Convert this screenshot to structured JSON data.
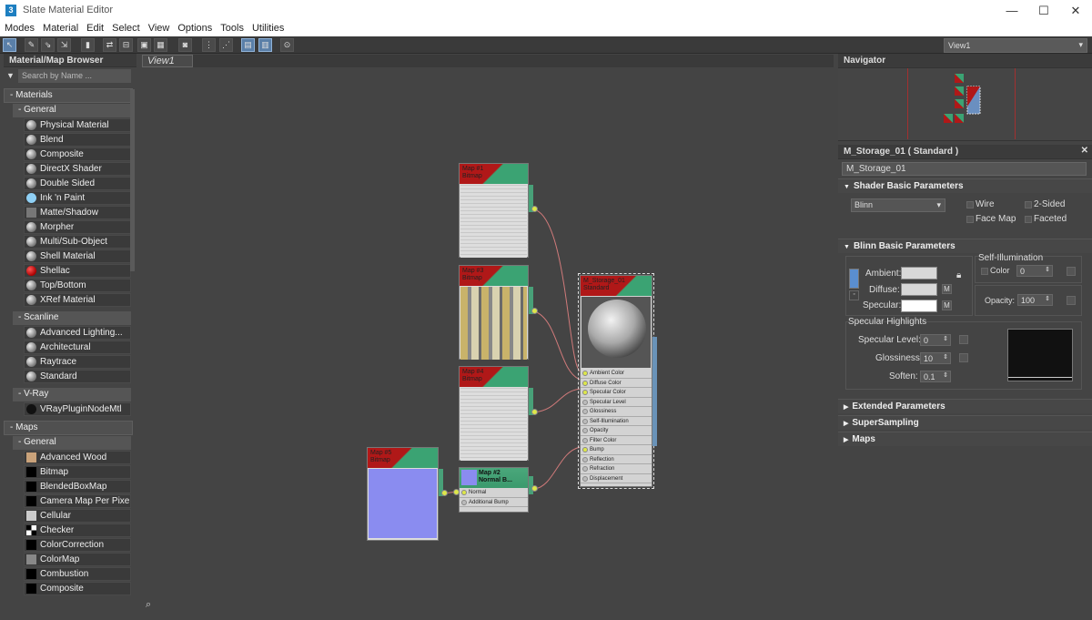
{
  "window": {
    "title": "Slate Material Editor",
    "app_icon": "3"
  },
  "menu": [
    "Modes",
    "Material",
    "Edit",
    "Select",
    "View",
    "Options",
    "Tools",
    "Utilities"
  ],
  "toolbar": {
    "view_select": "View1"
  },
  "browser": {
    "title": "Material/Map Browser",
    "search_placeholder": "Search by Name ...",
    "materials_label": "- Materials",
    "general_label": "- General",
    "general_items": [
      "Physical Material",
      "Blend",
      "Composite",
      "DirectX Shader",
      "Double Sided",
      "Ink 'n Paint",
      "Matte/Shadow",
      "Morpher",
      "Multi/Sub-Object",
      "Shell Material",
      "Shellac",
      "Top/Bottom",
      "XRef Material"
    ],
    "scanline_label": "- Scanline",
    "scanline_items": [
      "Advanced Lighting...",
      "Architectural",
      "Raytrace",
      "Standard"
    ],
    "vray_label": "- V-Ray",
    "vray_items": [
      "VRayPluginNodeMtl"
    ],
    "maps_label": "- Maps",
    "maps_general_label": "- General",
    "maps_items": [
      "Advanced Wood",
      "Bitmap",
      "BlendedBoxMap",
      "Camera Map Per Pixel",
      "Cellular",
      "Checker",
      "ColorCorrection",
      "ColorMap",
      "Combustion",
      "Composite"
    ]
  },
  "view": {
    "tab": "View1",
    "nodes": {
      "map1": {
        "title": "Map #1",
        "sub": "Bitmap"
      },
      "map2": {
        "title": "Map #3",
        "sub": "Bitmap"
      },
      "map3": {
        "title": "Map #4",
        "sub": "Bitmap"
      },
      "map4": {
        "title": "Map #5",
        "sub": "Bitmap"
      },
      "normal": {
        "title": "Map #2",
        "sub": "Normal B...",
        "ports": [
          "Normal",
          "Additional Bump"
        ]
      },
      "material": {
        "title": "M_Storage_01",
        "sub": "Standard",
        "ports": [
          "Ambient Color",
          "Diffuse Color",
          "Specular Color",
          "Specular Level",
          "Glossiness",
          "Self-Illumination",
          "Opacity",
          "Filter Color",
          "Bump",
          "Reflection",
          "Refraction",
          "Displacement"
        ]
      }
    }
  },
  "navigator": {
    "title": "Navigator"
  },
  "params": {
    "header": "M_Storage_01  ( Standard )",
    "name_field": "M_Storage_01",
    "shader_section": "Shader Basic Parameters",
    "shader": "Blinn",
    "wire": "Wire",
    "two_sided": "2-Sided",
    "face_map": "Face Map",
    "faceted": "Faceted",
    "blinn_section": "Blinn Basic Parameters",
    "self_illum": "Self-Illumination",
    "color_label": "Color",
    "color_value": "0",
    "ambient": "Ambient:",
    "diffuse": "Diffuse:",
    "specular": "Specular:",
    "m": "M",
    "opacity_label": "Opacity:",
    "opacity_value": "100",
    "spec_highlights": "Specular Highlights",
    "spec_level_label": "Specular Level:",
    "spec_level": "0",
    "glossiness_label": "Glossiness:",
    "glossiness": "10",
    "soften_label": "Soften:",
    "soften": "0.1",
    "extended": "Extended Parameters",
    "supersampling": "SuperSampling",
    "maps": "Maps"
  }
}
